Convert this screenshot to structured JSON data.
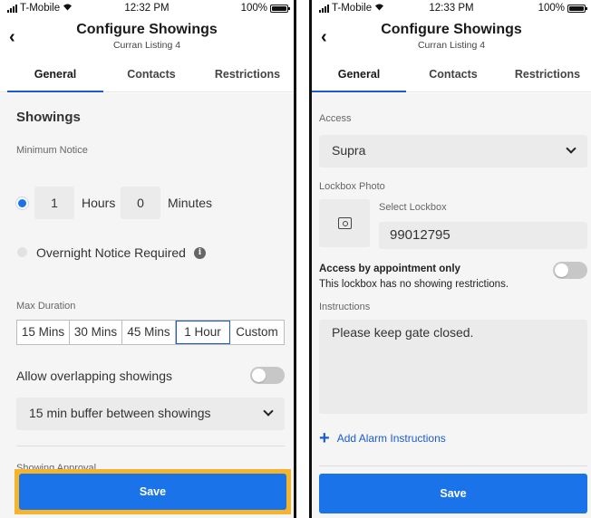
{
  "left": {
    "status": {
      "carrier": "T-Mobile",
      "time": "12:32 PM",
      "battery": "100%"
    },
    "header": {
      "title": "Configure Showings",
      "subtitle": "Curran Listing 4"
    },
    "tabs": [
      {
        "label": "General",
        "active": true
      },
      {
        "label": "Contacts",
        "active": false
      },
      {
        "label": "Restrictions",
        "active": false
      }
    ],
    "showings_title": "Showings",
    "minimum_notice_label": "Minimum Notice",
    "hours_value": "1",
    "hours_label": "Hours",
    "minutes_value": "0",
    "minutes_label": "Minutes",
    "overnight_label": "Overnight Notice Required",
    "max_duration_label": "Max Duration",
    "durations": [
      "15 Mins",
      "30 Mins",
      "45 Mins",
      "1 Hour",
      "Custom"
    ],
    "selected_duration": "1 Hour",
    "overlap_label": "Allow overlapping showings",
    "overlap_enabled": false,
    "buffer_value": "15 min buffer between showings",
    "approval_label": "Showing Approval",
    "save_label": "Save"
  },
  "right": {
    "status": {
      "carrier": "T-Mobile",
      "time": "12:33 PM",
      "battery": "100%"
    },
    "header": {
      "title": "Configure Showings",
      "subtitle": "Curran Listing 4"
    },
    "tabs": [
      {
        "label": "General",
        "active": true
      },
      {
        "label": "Contacts",
        "active": false
      },
      {
        "label": "Restrictions",
        "active": false
      }
    ],
    "access_label": "Access",
    "access_value": "Supra",
    "lockbox_photo_label": "Lockbox Photo",
    "select_lockbox_label": "Select Lockbox",
    "lockbox_value": "99012795",
    "appointment_title": "Access by appointment only",
    "appointment_desc": "This lockbox has no showing restrictions.",
    "appointment_enabled": false,
    "instructions_label": "Instructions",
    "instructions_value": "Please keep gate closed.",
    "add_alarm_label": "Add Alarm Instructions",
    "save_label": "Save"
  },
  "colors": {
    "accent": "#1a73e8",
    "highlight": "#f6b42c",
    "tab_indicator": "#1a5ccf"
  }
}
